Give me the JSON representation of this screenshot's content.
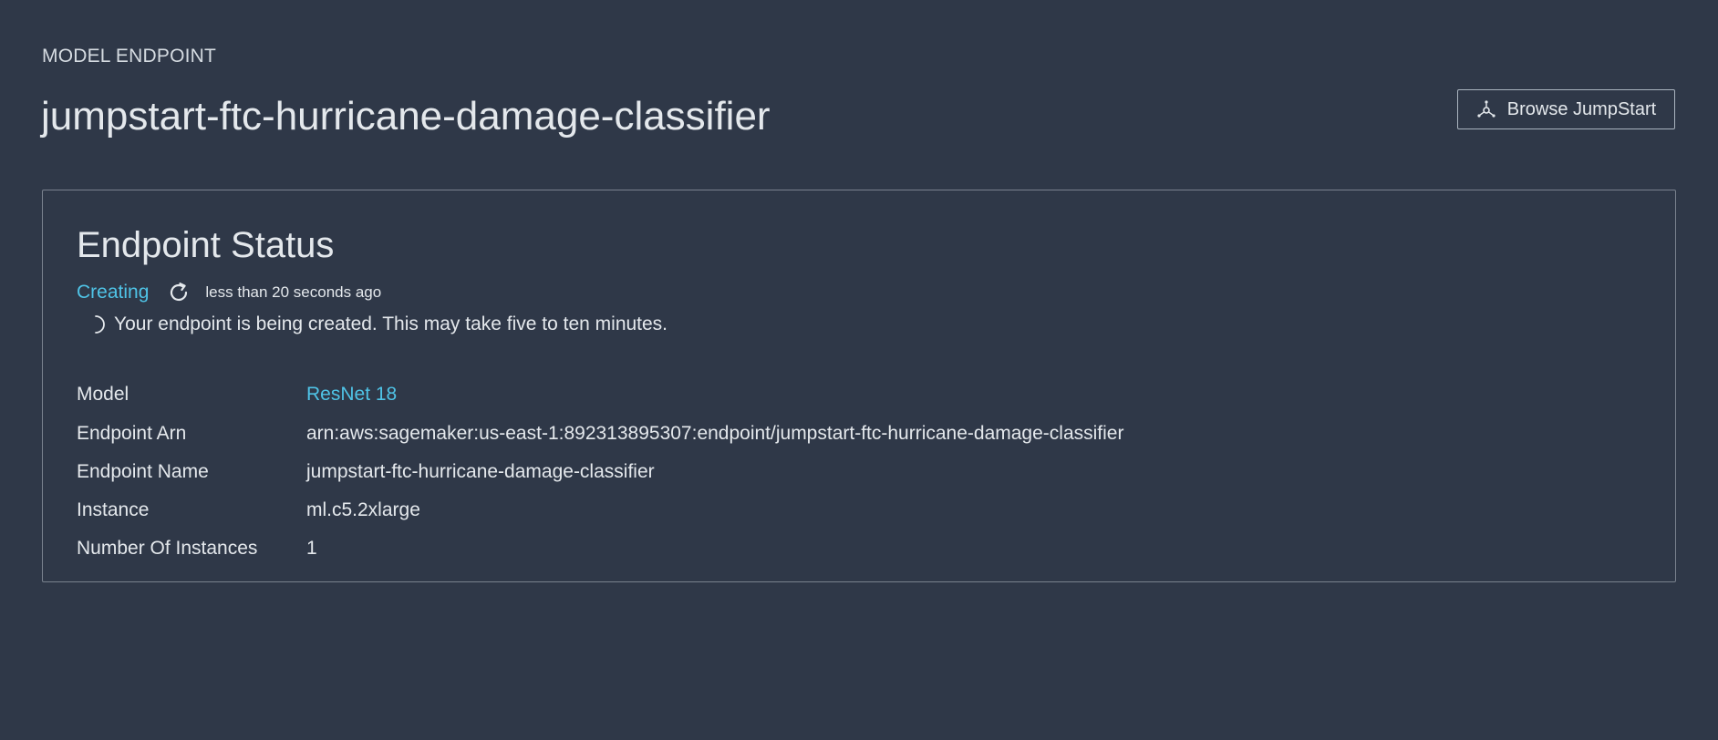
{
  "header": {
    "eyebrow": "MODEL ENDPOINT",
    "title": "jumpstart-ftc-hurricane-damage-classifier",
    "browse_button_label": "Browse JumpStart",
    "browse_button_icon": "network-nodes-icon"
  },
  "panel": {
    "title": "Endpoint Status",
    "status": {
      "label": "Creating",
      "color": "#4fc3e6",
      "refresh_icon": "refresh-icon",
      "updated": "less than 20 seconds ago"
    },
    "progress_message": "Your endpoint is being created. This may take five to ten minutes.",
    "details": [
      {
        "label": "Model",
        "value": "ResNet 18",
        "is_link": true
      },
      {
        "label": "Endpoint Arn",
        "value": "arn:aws:sagemaker:us-east-1:892313895307:endpoint/jumpstart-ftc-hurricane-damage-classifier",
        "is_link": false
      },
      {
        "label": "Endpoint Name",
        "value": "jumpstart-ftc-hurricane-damage-classifier",
        "is_link": false
      },
      {
        "label": "Instance",
        "value": "ml.c5.2xlarge",
        "is_link": false
      },
      {
        "label": "Number Of Instances",
        "value": "1",
        "is_link": false
      }
    ]
  },
  "colors": {
    "background": "#2f3848",
    "accent_link": "#4fc3e6",
    "panel_border": "#7a828e"
  }
}
